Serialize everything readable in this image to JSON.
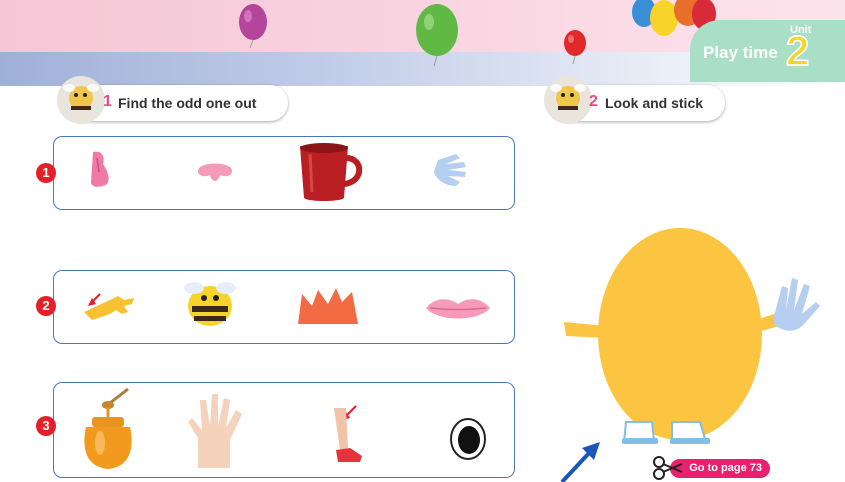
{
  "header": {
    "play_time": "Play time",
    "unit_label": "Unit",
    "unit_number": "2"
  },
  "section1": {
    "number": "1",
    "title": "Find the odd one out",
    "rows": [
      {
        "number": "1",
        "items": [
          "nose",
          "nose",
          "cup",
          "hand"
        ]
      },
      {
        "number": "2",
        "items": [
          "arm",
          "bee",
          "hair",
          "lips"
        ]
      },
      {
        "number": "3",
        "items": [
          "honey",
          "hand",
          "leg",
          "eye"
        ]
      }
    ]
  },
  "section2": {
    "number": "2",
    "title": "Look and stick",
    "goto_label": "Go to page 73"
  },
  "colors": {
    "accent_pink": "#e84b84",
    "row_number_red": "#e51f2a",
    "box_border_blue": "#4a76c0",
    "egg_yellow": "#fcc541",
    "tab_green": "#a9dfc6"
  },
  "icons": [
    "bee-mascot-icon",
    "scissors-icon",
    "balloon-icon",
    "arrow-icon"
  ]
}
